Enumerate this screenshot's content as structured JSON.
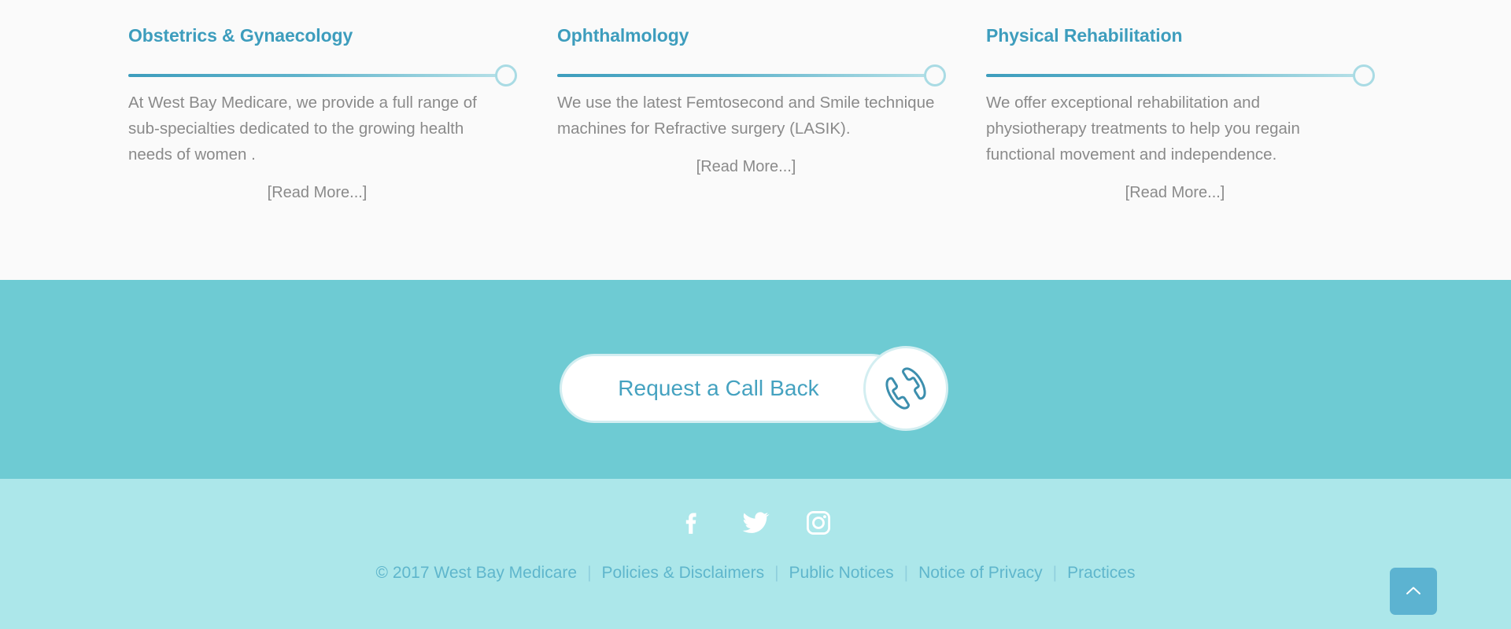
{
  "services": {
    "columns": [
      {
        "title": "Obstetrics & Gynaecology",
        "body": "At West Bay Medicare, we provide a full range of sub-specialties dedicated to the growing health needs of women .",
        "read_more": "[Read More...]"
      },
      {
        "title": "Ophthalmology",
        "body": "We use the latest Femtosecond and Smile technique machines for Refractive surgery (LASIK).",
        "read_more": "[Read More...]"
      },
      {
        "title": "Physical Rehabilitation",
        "body": "We offer exceptional rehabilitation and physiotherapy treatments to help you regain functional movement and independence.",
        "read_more": "[Read More...]"
      }
    ]
  },
  "cta": {
    "label": "Request a Call Back",
    "icon": "phone-handset-icon"
  },
  "footer": {
    "social": [
      {
        "name": "facebook-icon",
        "label": "Facebook"
      },
      {
        "name": "twitter-icon",
        "label": "Twitter"
      },
      {
        "name": "instagram-icon",
        "label": "Instagram"
      }
    ],
    "copyright": "© 2017 West Bay Medicare",
    "separator": "|",
    "links": [
      "Policies & Disclaimers",
      "Public Notices",
      "Notice of Privacy",
      "Practices"
    ]
  },
  "scroll_top": {
    "icon": "chevron-up-icon"
  },
  "colors": {
    "accent_teal": "#3d9dbd",
    "cta_band": "#6ecbd3",
    "footer_band": "#ace7ea",
    "services_bg": "#fafafa",
    "body_text": "#8a8a8a",
    "link_teal": "#5fb6cc",
    "scroll_button": "#5cb3d1"
  }
}
